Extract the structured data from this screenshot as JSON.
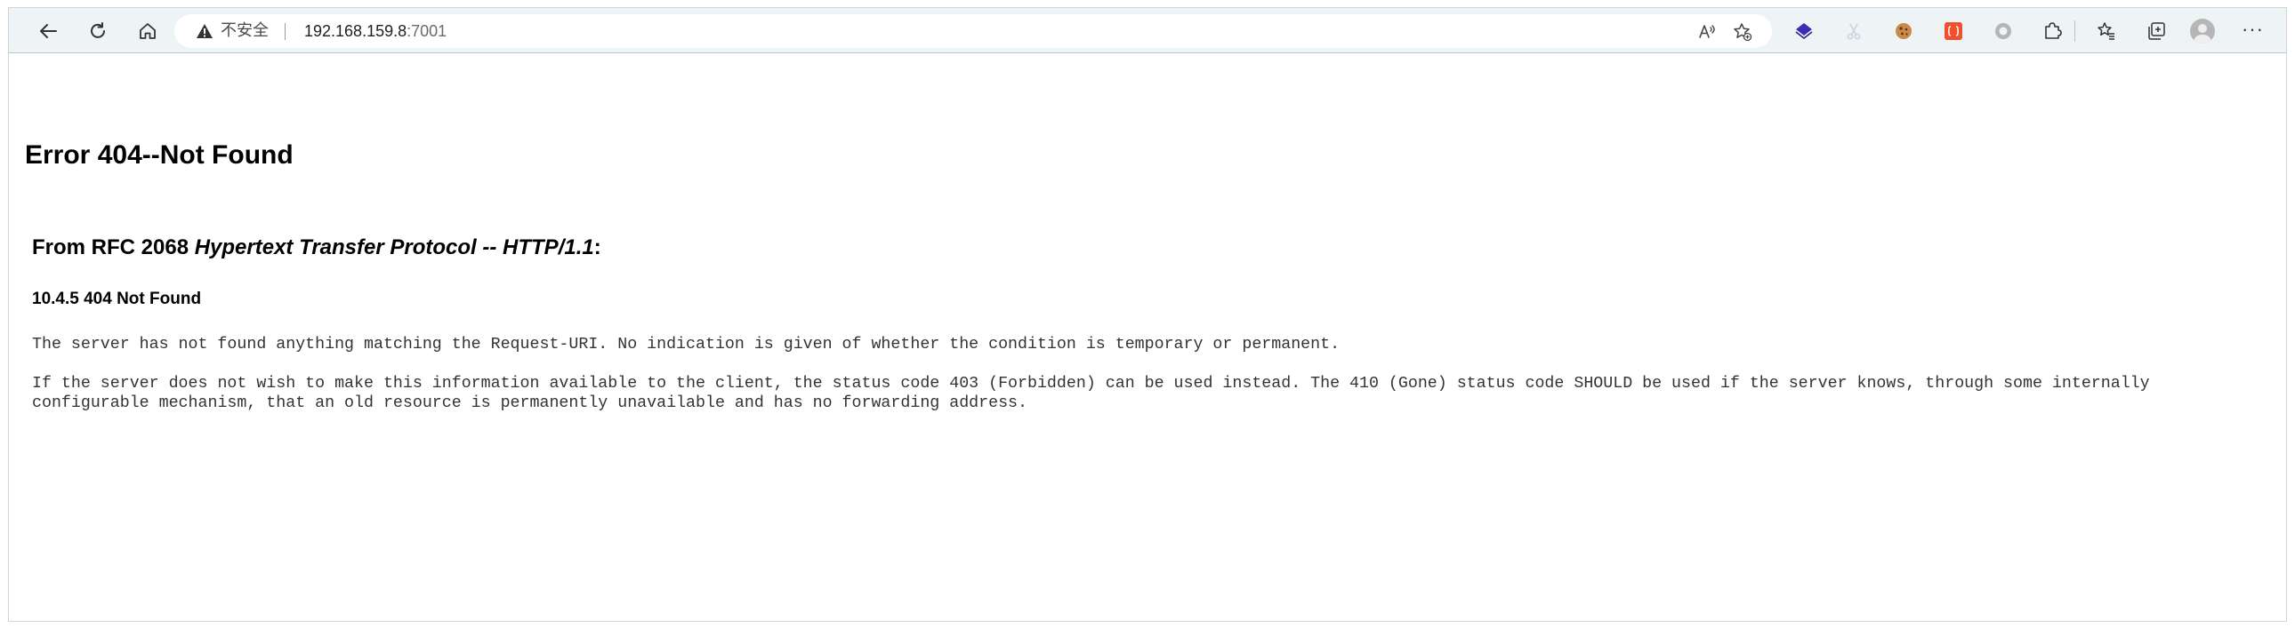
{
  "browser": {
    "security_label": "不安全",
    "url_host": "192.168.159.8",
    "url_port": ":7001",
    "icons": {
      "back": "back-arrow-icon",
      "refresh": "refresh-icon",
      "home": "home-icon",
      "warning": "warning-triangle-icon",
      "read_aloud": "read-aloud-icon",
      "favorite_add": "add-favorite-icon",
      "favorites": "favorites-icon",
      "collections": "collections-icon",
      "more": "more-icon"
    },
    "more_label": "···"
  },
  "page": {
    "title": "Error 404--Not Found",
    "rfc_prefix": "From RFC 2068 ",
    "rfc_italic": "Hypertext Transfer Protocol -- HTTP/1.1",
    "rfc_suffix": ":",
    "section_heading": "10.4.5 404 Not Found",
    "paragraph1": "The server has not found anything matching the Request-URI. No indication is given of whether the condition is temporary or permanent.",
    "paragraph2": "If the server does not wish to make this information available to the client, the status code 403 (Forbidden) can be used instead. The 410 (Gone) status code SHOULD be used if the server knows, through some internally configurable mechanism, that an old resource is permanently unavailable and has no forwarding address."
  },
  "colors": {
    "toolbar_bg": "#eef3f5",
    "accent_purple": "#3b2db5",
    "ext_red": "#f0502e"
  }
}
